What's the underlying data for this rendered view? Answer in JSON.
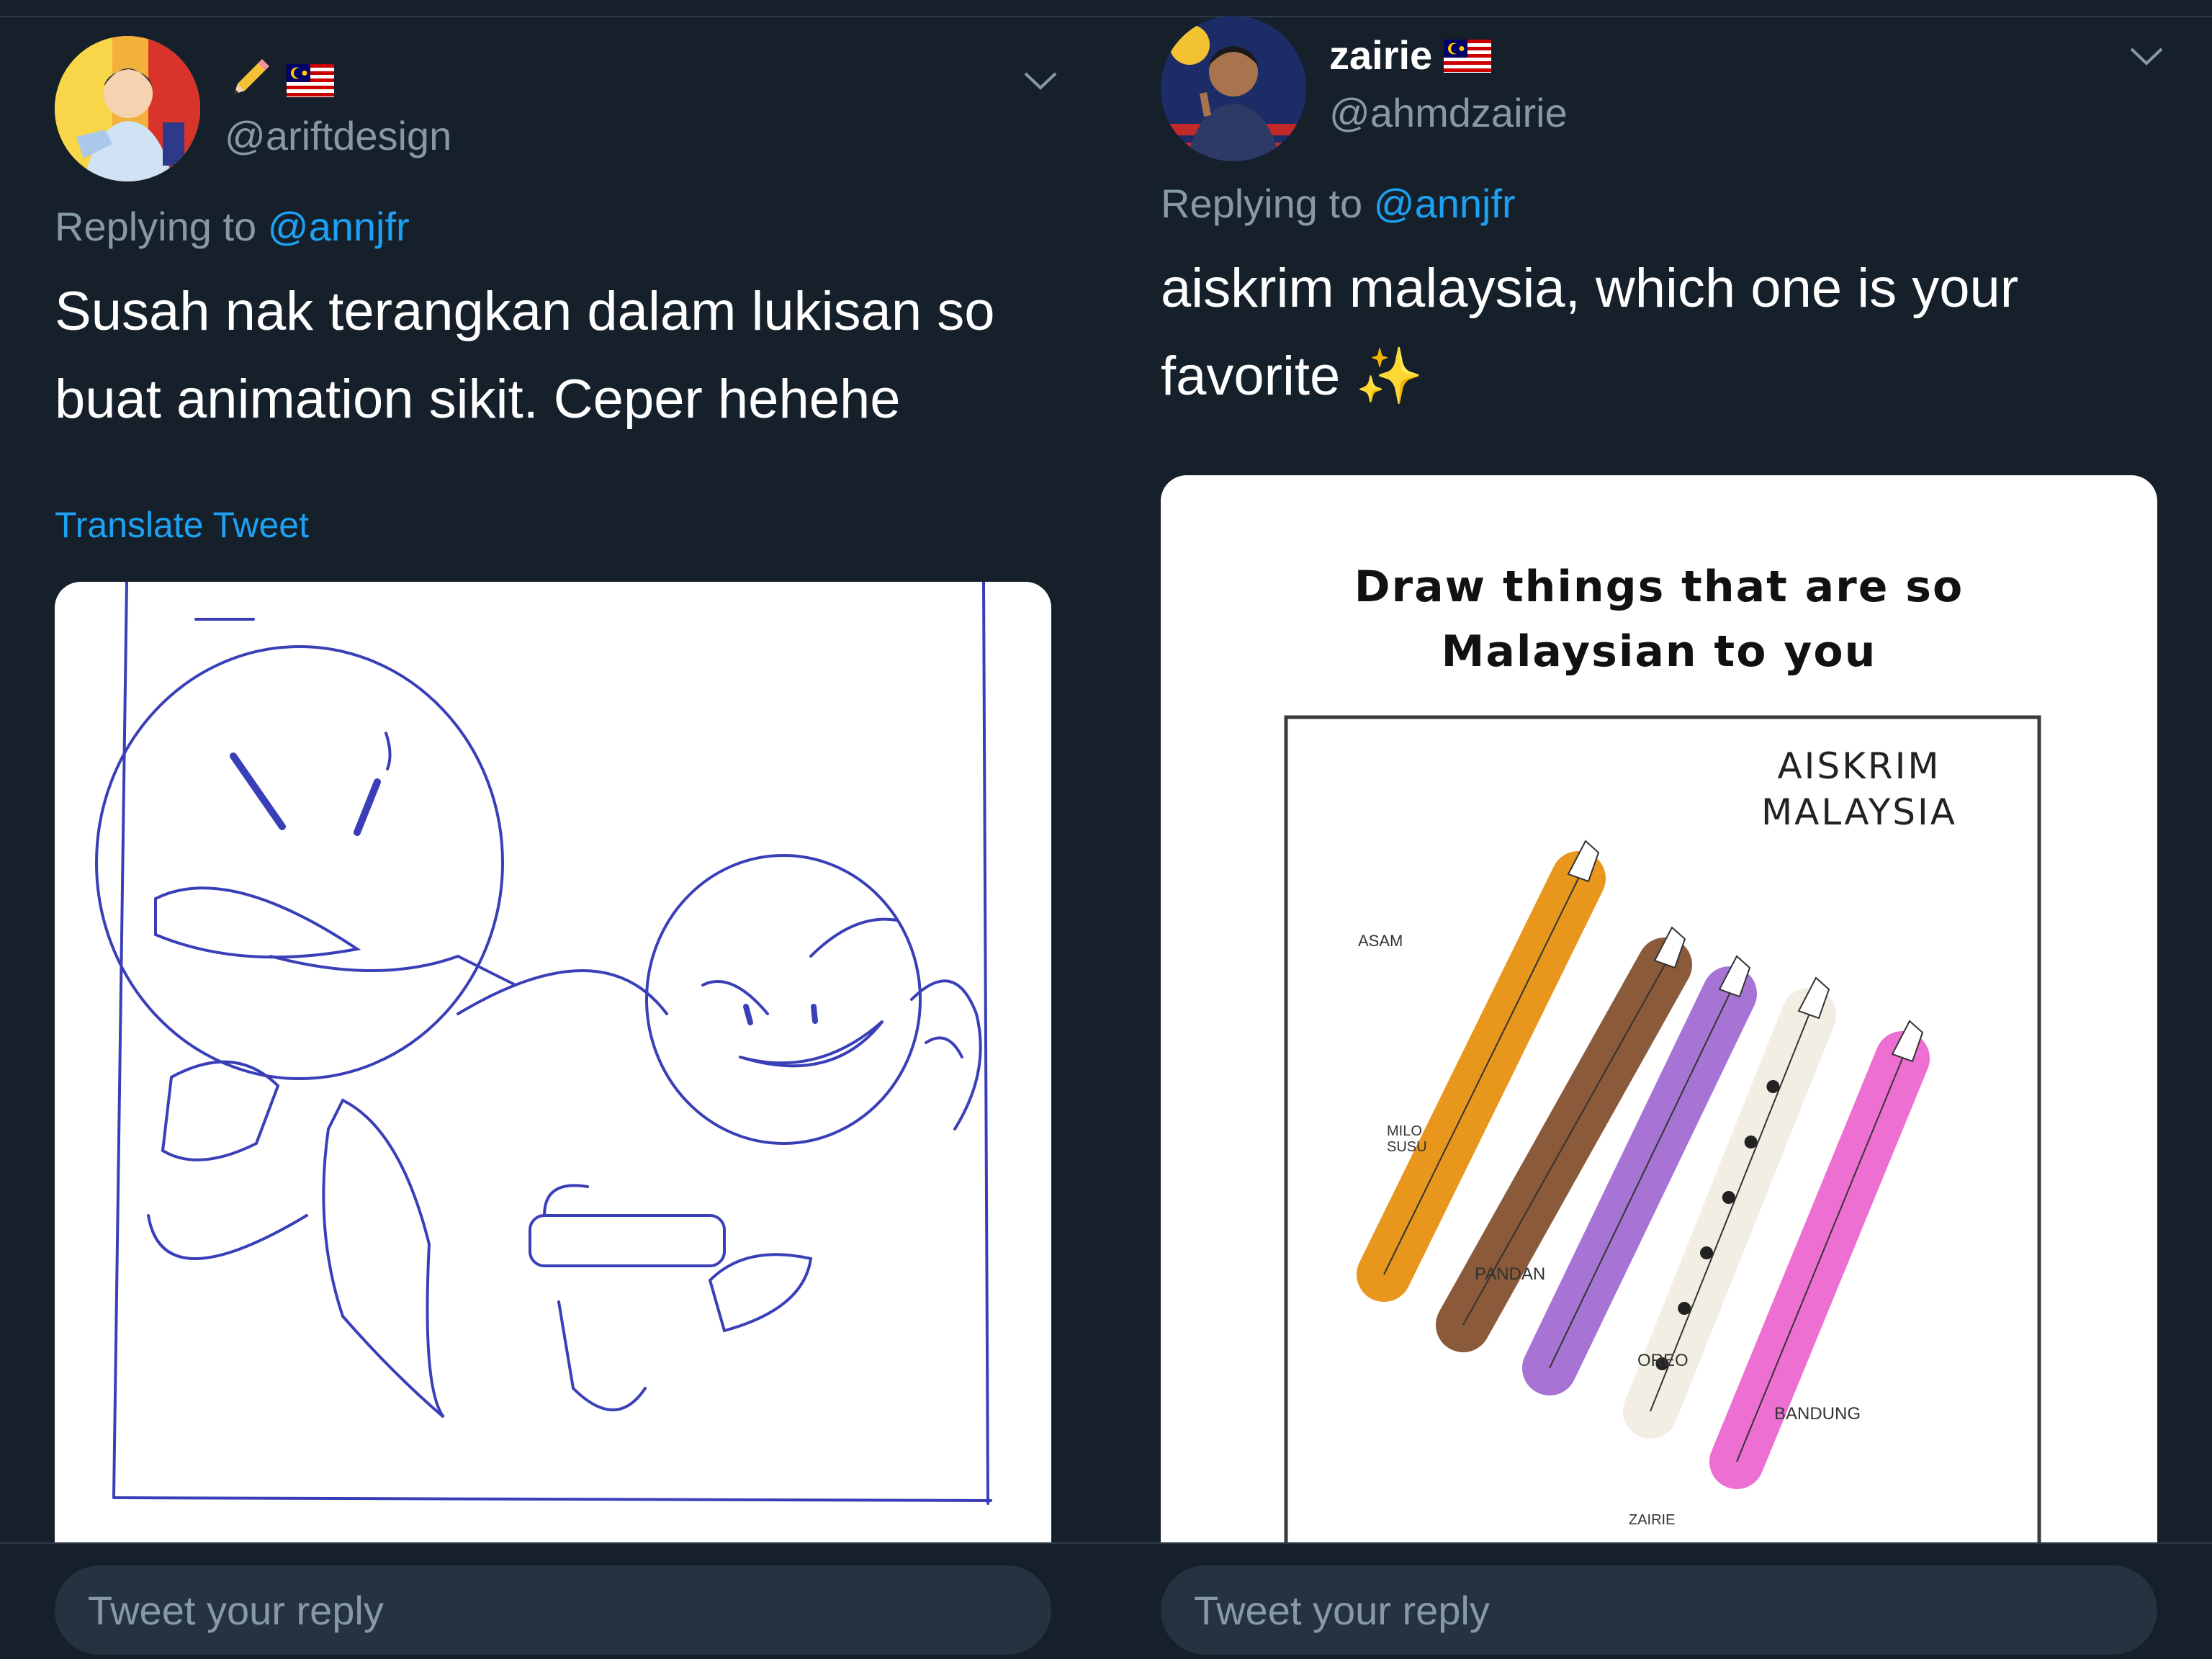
{
  "left_tweet": {
    "display_name": "",
    "name_emoji": [
      "pencil-emoji",
      "malaysia-flag-emoji"
    ],
    "handle": "@ariftdesign",
    "replying_label": "Replying to",
    "replying_to": "@annjfr",
    "text_line1": "Susah nak terangkan dalam lukisan so",
    "text_line2": "buat animation sikit. Ceper hehehe",
    "translate": "Translate Tweet",
    "media": "sketch-animation-frame"
  },
  "right_tweet": {
    "display_name": "zairie",
    "name_emoji": [
      "malaysia-flag-emoji"
    ],
    "handle": "@ahmdzairie",
    "replying_label": "Replying to",
    "replying_to": "@annjfr",
    "text_line1": "aiskrim malaysia, which one is your",
    "text_line2": "favorite",
    "text_emoji": "✨",
    "media": {
      "heading_line1": "Draw things that are so",
      "heading_line2": "Malaysian to you",
      "title_line1": "AISKRIM",
      "title_line2": "MALAYSIA",
      "flavors": [
        {
          "label": "ASAM",
          "color": "#e8961c"
        },
        {
          "label": "MILO SUSU",
          "color": "#8a5a3a"
        },
        {
          "label": "PANDAN",
          "color": "#a774d6"
        },
        {
          "label": "OREO",
          "color": "#f3eee4"
        },
        {
          "label": "BANDUNG",
          "color": "#ee6fd2"
        }
      ],
      "label_milo_line1": "MILO",
      "label_milo_line2": "SUSU",
      "signature": "ZAIRIE"
    }
  },
  "reply_placeholder": "Tweet your reply",
  "colors": {
    "background": "#15202b",
    "accent": "#1da1f2",
    "muted": "#8899a6"
  }
}
